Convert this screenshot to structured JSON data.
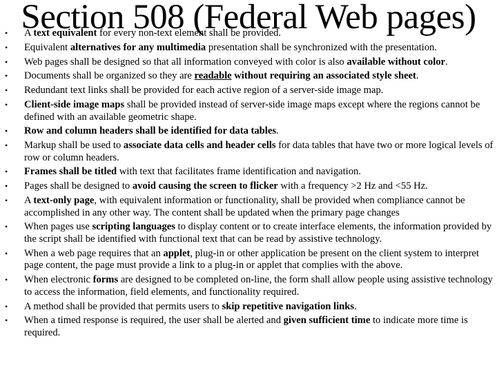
{
  "slide": {
    "title": "Section 508 (Federal Web pages)",
    "bullets": [
      [
        {
          "t": "A "
        },
        {
          "t": "text equivalent",
          "b": true
        },
        {
          "t": " for every non-text element shall be provided."
        }
      ],
      [
        {
          "t": "Equivalent "
        },
        {
          "t": "alternatives for any multimedia",
          "b": true
        },
        {
          "t": " presentation shall be synchronized with the presentation."
        }
      ],
      [
        {
          "t": "Web pages shall be designed so that all information conveyed with color is also "
        },
        {
          "t": "available without color",
          "b": true
        },
        {
          "t": "."
        }
      ],
      [
        {
          "t": "Documents shall be organized so they are "
        },
        {
          "t": "readable",
          "b": true,
          "u": true
        },
        {
          "t": " without requiring an associated style sheet",
          "b": true
        },
        {
          "t": "."
        }
      ],
      [
        {
          "t": "Redundant text links shall be provided for each active region of a server-side image map."
        }
      ],
      [
        {
          "t": "Client-side image maps",
          "b": true
        },
        {
          "t": " shall be provided instead of server-side image maps except where the regions cannot be defined with an available geometric shape."
        }
      ],
      [
        {
          "t": "Row and column headers shall be identified for data tables",
          "b": true
        },
        {
          "t": "."
        }
      ],
      [
        {
          "t": "Markup shall be used to "
        },
        {
          "t": "associate data cells and header cells",
          "b": true
        },
        {
          "t": " for data tables that have two or more logical levels of row or column headers."
        }
      ],
      [
        {
          "t": "Frames shall be titled",
          "b": true
        },
        {
          "t": " with text that facilitates frame identification and navigation."
        }
      ],
      [
        {
          "t": "Pages shall be designed to "
        },
        {
          "t": "avoid causing the screen to flicker",
          "b": true
        },
        {
          "t": " with a frequency >2 Hz and <55 Hz."
        }
      ],
      [
        {
          "t": "A "
        },
        {
          "t": "text-only page",
          "b": true
        },
        {
          "t": ", with equivalent information or functionality, shall be provided when compliance cannot be accomplished in any other way. The content shall be updated when the primary page changes"
        }
      ],
      [
        {
          "t": "When pages use "
        },
        {
          "t": "scripting languages",
          "b": true
        },
        {
          "t": " to display content or to create interface elements, the information provided by the script shall be identified with functional text that can be read by assistive technology."
        }
      ],
      [
        {
          "t": "When a web page requires that an "
        },
        {
          "t": "applet",
          "b": true
        },
        {
          "t": ", plug-in or other application be present on the client system to interpret page content, the page must provide a link to a plug-in or applet that complies with the above."
        }
      ],
      [
        {
          "t": "When electronic "
        },
        {
          "t": "forms",
          "b": true
        },
        {
          "t": " are designed to be completed on-line, the form shall allow people using assistive technology to access the information, field elements, and functionality required."
        }
      ],
      [
        {
          "t": "A method shall be provided that permits users to "
        },
        {
          "t": "skip repetitive navigation links",
          "b": true
        },
        {
          "t": "."
        }
      ],
      [
        {
          "t": "When a timed response is required, the user shall be alerted and "
        },
        {
          "t": "given sufficient time",
          "b": true
        },
        {
          "t": " to indicate more time is required."
        }
      ]
    ],
    "bullet_glyph": "•"
  }
}
